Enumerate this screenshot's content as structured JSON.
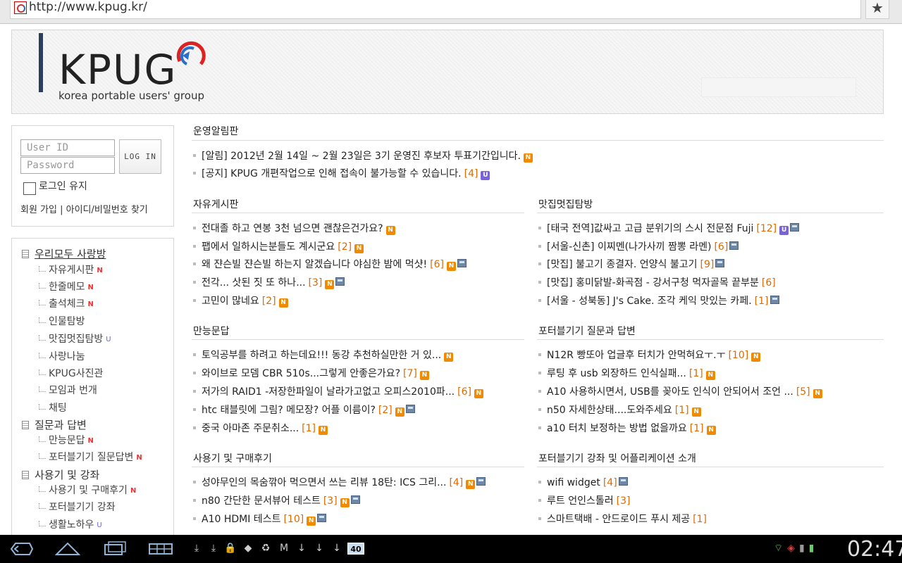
{
  "browser": {
    "url": "http://www.kpug.kr/",
    "bookmark_icon": "star-icon"
  },
  "header": {
    "logo_text": "KPUG",
    "logo_subtitle": "korea portable users' group"
  },
  "login": {
    "userid_placeholder": "User ID",
    "password_placeholder": "Password",
    "login_button": "LOG IN",
    "remember_label": "로그인 유지",
    "links": "회원 가입 | 아이디/비밀번호 찾기"
  },
  "menu": {
    "groups": [
      {
        "label": "우리모두 사랑방"
      },
      {
        "label": "질문과 답변"
      },
      {
        "label": "사용기 및 강좌"
      }
    ],
    "items": [
      {
        "label": "자유게시판",
        "badge": "N"
      },
      {
        "label": "한줄메모",
        "badge": "N"
      },
      {
        "label": "출석체크",
        "badge": "N"
      },
      {
        "label": "인물탐방",
        "badge": ""
      },
      {
        "label": "맛집멋집탐방",
        "badge": "U"
      },
      {
        "label": "사랑나눔",
        "badge": ""
      },
      {
        "label": "KPUG사진관",
        "badge": ""
      },
      {
        "label": "모임과 번개",
        "badge": ""
      },
      {
        "label": "채팅",
        "badge": ""
      },
      {
        "label": "만능문답",
        "badge": "N"
      },
      {
        "label": "포터블기기 질문답변",
        "badge": "N"
      },
      {
        "label": "사용기 및 구매후기",
        "badge": "N"
      },
      {
        "label": "포터블기기 강좌",
        "badge": ""
      },
      {
        "label": "생활노하우",
        "badge": "U"
      }
    ]
  },
  "sections": {
    "notice": {
      "title": "운영알림판",
      "posts": [
        {
          "text": "[알림] 2012년 2월 14일 ~ 2월 23일은 3기 운영진 후보자 투표기간입니다.",
          "count": ""
        },
        {
          "text": "[공지] KPUG 개편작업으로 인해 접속이 불가능할 수 있습니다.",
          "count": "[4]"
        }
      ]
    },
    "free": {
      "title": "자유게시판",
      "posts": [
        {
          "text": "전대졸 하고 연봉 3천 넘으면 괜찮은건가요?",
          "count": ""
        },
        {
          "text": "팹에서 일하시는분들도 계시군요",
          "count": "[2]"
        },
        {
          "text": "왜 쟌슨빌 쟌슨빌 하는지 알겠습니다 야심한 밤에 먹샷!",
          "count": "[6]"
        },
        {
          "text": "전각... 삿된 짓 또 하나...",
          "count": "[3]"
        },
        {
          "text": "고민이 많네요",
          "count": "[2]"
        }
      ]
    },
    "food": {
      "title": "맛집멋집탐방",
      "posts": [
        {
          "text": "[태국 전역]값싸고 고급 분위기의 스시 전문점 Fuji",
          "count": "[12]"
        },
        {
          "text": "[서울-신촌] 이찌멘(나가사끼 짬뽕 라멘)",
          "count": "[6]"
        },
        {
          "text": "[맛집] 불고기 종결자. 언양식 불고기",
          "count": "[9]"
        },
        {
          "text": "[맛집] 홍미닭발-화곡점 - 강서구청 먹자골목 끝부분",
          "count": "[6]"
        },
        {
          "text": "[서울 - 성북동] J's Cake. 조각 케익 맛있는 카페.",
          "count": "[1]"
        }
      ]
    },
    "qna": {
      "title": "만능문답",
      "posts": [
        {
          "text": "토익공부를 하려고 하는데요!!! 동강 추천하실만한 거 있...",
          "count": ""
        },
        {
          "text": "와이브로 모뎀 CBR 510s...그렇게 안좋은가요?",
          "count": "[7]"
        },
        {
          "text": "저가의 RAID1 -저장한파일이 날라가고없고 오피스2010파...",
          "count": "[6]"
        },
        {
          "text": "htc 태블릿에 그림? 메모장? 어플 이름이?",
          "count": "[2]"
        },
        {
          "text": "중국 아마존 주문취소...",
          "count": "[1]"
        }
      ]
    },
    "portable_qna": {
      "title": "포터블기기 질문과 답변",
      "posts": [
        {
          "text": "N12R 빵또아 업글후 터치가 안먹혀요ㅜ.ㅜ",
          "count": "[10]"
        },
        {
          "text": "루팅 후 usb 외장하드 인식실패...",
          "count": "[1]"
        },
        {
          "text": "A10 사용하시면서, USB를 꽂아도 인식이 안되어서 조언 ...",
          "count": "[5]"
        },
        {
          "text": "n50 자세한상태....도와주세요",
          "count": "[1]"
        },
        {
          "text": "a10 터치 보정하는 방법 없을까요",
          "count": "[1]"
        }
      ]
    },
    "reviews": {
      "title": "사용기 및 구매후기",
      "posts": [
        {
          "text": "성야무인의 목숨깎아 먹으면서 쓰는 리뷰 18탄: ICS 그리...",
          "count": "[4]"
        },
        {
          "text": "n80 간단한 문서뷰어 테스트",
          "count": "[3]"
        },
        {
          "text": "A10 HDMI 테스트",
          "count": "[10]"
        }
      ]
    },
    "lectures": {
      "title": "포터블기기 강좌 및 어플리케이션 소개",
      "posts": [
        {
          "text": "wifi widget",
          "count": "[4]"
        },
        {
          "text": "루트 언인스톨러",
          "count": "[3]"
        },
        {
          "text": "스마트택배 - 안드로이드 푸시 제공",
          "count": "[1]"
        }
      ]
    }
  },
  "system_bar": {
    "notification_count": "40",
    "clock": "02:47",
    "status_color": "#66cc66"
  }
}
